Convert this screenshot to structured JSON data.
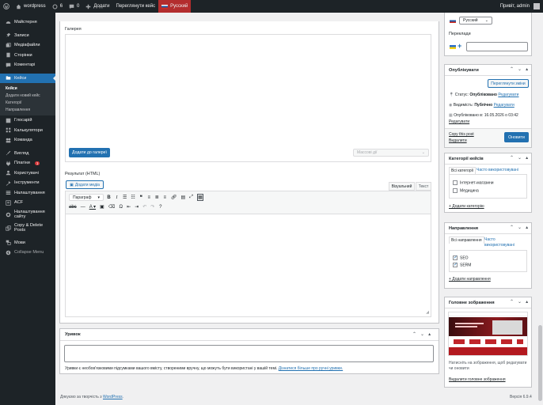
{
  "adminbar": {
    "site_name": "wordpress",
    "updates_count": "6",
    "comments_count": "0",
    "add_new": "Додати",
    "view_case": "Переглянути кейс",
    "language": "Русский",
    "greeting": "Привіт, admin"
  },
  "sidebar": {
    "items": [
      {
        "label": "Майстерня",
        "icon": "dashboard-icon"
      },
      {
        "label": "Записи",
        "icon": "pin-icon"
      },
      {
        "label": "Медіафайли",
        "icon": "media-icon"
      },
      {
        "label": "Сторінки",
        "icon": "page-icon"
      },
      {
        "label": "Коментарі",
        "icon": "comment-icon"
      },
      {
        "label": "Кейси",
        "icon": "folder-icon"
      },
      {
        "label": "Глосарій",
        "icon": "book-icon"
      },
      {
        "label": "Калькулятори",
        "icon": "grid-icon"
      },
      {
        "label": "Команда",
        "icon": "team-icon"
      },
      {
        "label": "Вигляд",
        "icon": "brush-icon"
      },
      {
        "label": "Плагіни",
        "icon": "plugin-icon",
        "badge": "1"
      },
      {
        "label": "Користувачі",
        "icon": "user-icon"
      },
      {
        "label": "Інструменти",
        "icon": "wrench-icon"
      },
      {
        "label": "Налаштування",
        "icon": "settings-icon"
      },
      {
        "label": "ACF",
        "icon": "acf-icon"
      },
      {
        "label": "Налаштування сайту",
        "icon": "gear-icon"
      },
      {
        "label": "Copy & Delete Posts",
        "icon": "copy-icon"
      },
      {
        "label": "Мови",
        "icon": "translate-icon"
      },
      {
        "label": "Collapse Menu",
        "icon": "collapse-icon"
      }
    ],
    "submenu": [
      "Кейси",
      "Додати новий кейс",
      "Категорії",
      "Направлення"
    ]
  },
  "gallery": {
    "label": "Галерея",
    "add_button": "Додати до галереї",
    "bulk_select": "Массові дії"
  },
  "result": {
    "label": "Результат (HTML)",
    "add_media": "Додати медіа",
    "tab_visual": "Візуальний",
    "tab_text": "Текст",
    "format_select": "Параграф"
  },
  "excerpt": {
    "title": "Уривок",
    "help_text": "Уривки є необов'язковими підсумками вашого вмісту, створеними вручну, що можуть бути використані у вашій темі.",
    "help_link": "Дізнатися більше про ручні уривки."
  },
  "footer": {
    "thanks": "Дякуємо за творчість з",
    "wp_link": "WordPress",
    "version": "Версія 6.9.4"
  },
  "language_box": {
    "selected": "Русский",
    "translations_label": "Переклади"
  },
  "publish": {
    "title": "Опублікувати",
    "view_changes": "Переглянути зміни",
    "status_label": "Статус:",
    "status_value": "Опубліковано",
    "visibility_label": "Видимість:",
    "visibility_value": "Публічно",
    "published_on": "Опубліковано в: 16.05.2026 о 03:42",
    "edit": "Редагувати",
    "copy_post": "Copy this post",
    "delete": "Видалити",
    "update": "Оновити"
  },
  "case_categories": {
    "title": "Категорії кейсів",
    "tab_all": "Всі категорії",
    "tab_used": "Часто використовувані",
    "items": [
      "Інтернет-магазини",
      "Медицина"
    ],
    "add_link": "+ Додати категорію"
  },
  "directions": {
    "title": "Направлення",
    "tab_all": "Всі направлення",
    "tab_used": "Часто використовувані",
    "items": [
      "SEO",
      "SERM"
    ],
    "add_link": "+ Додати направлення"
  },
  "featured_image": {
    "title": "Головне зображення",
    "help": "Натисніть на зображення, щоб редагувати чи оновити",
    "remove": "Видалити головне зображення"
  },
  "colors": {
    "adminbar": "#1d2327",
    "accent": "#2271b1",
    "danger": "#b32d2e",
    "badge": "#d63638"
  }
}
